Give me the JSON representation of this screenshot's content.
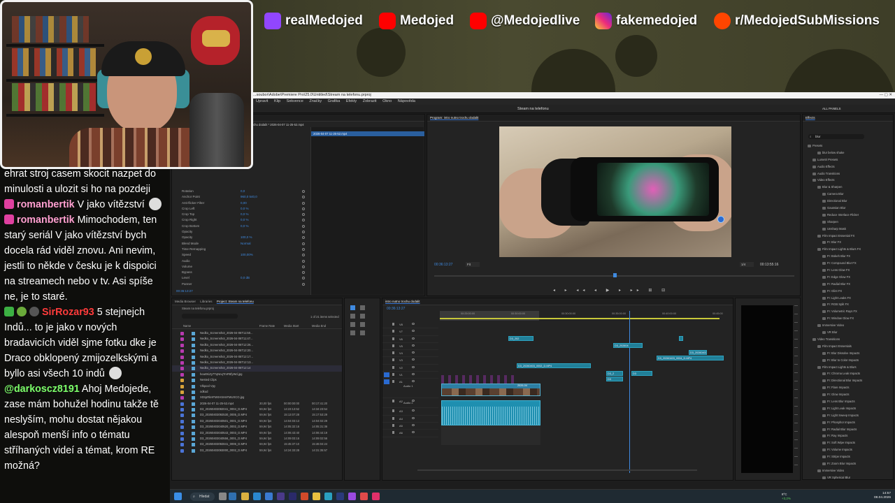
{
  "banner": {
    "socials": [
      {
        "platform": "twitch-icon",
        "handle": "realMedojed",
        "color": "#9146ff"
      },
      {
        "platform": "youtube-icon",
        "handle": "Medojed",
        "color": "#ff0000"
      },
      {
        "platform": "youtube-icon",
        "handle": "@Medojedlive",
        "color": "#ff0000"
      },
      {
        "platform": "instagram-icon",
        "handle": "fakemedojed",
        "color": "#d62976"
      },
      {
        "platform": "reddit-icon",
        "handle": "r/MedojedSubMissions",
        "color": "#ff4500"
      }
    ]
  },
  "chat": {
    "messages": [
      {
        "user": "",
        "text": "ehrat stroj casem skocit nazpet do minulosti a ulozit si ho na pozdeji",
        "user_color": "#ffffff"
      },
      {
        "user": "romanbertik",
        "text": "V jako vítězství",
        "user_color": "#ff9fd0",
        "emote_after": "ghost-emote"
      },
      {
        "user": "romanbertik",
        "text": "Mimochodem, ten starý seriál V jako vítězství bych docela rád viděl znovu. Ani nevim, jestli to někde v česku je k dispoici na streamech nebo v tv. Asi spíše ne, je to staré.",
        "user_color": "#ff9fd0"
      },
      {
        "user": "SirRozar93",
        "text": "5 stejnejch Indů... to je jako v nových bradavicích viděl sjme fotku dke je Draco obklopený zmijozelkskými a byllo asi všech 10 indů",
        "user_color": "#ff3b3b"
      },
      {
        "user": "@darkoscz8191",
        "text": "Ahoj Medojede, zase mám bohužel hodinu takže tě neslyším, mohu dostat nějakou alespoň menší info o tématu stříhaných videí a témat, krom RE možná?",
        "user_color": "#7cff6a"
      }
    ]
  },
  "premiere": {
    "titlebar": "...soubor\\Adobe\\Premiere Pro\\25.0\\Untitled\\Stream na telefonu.prproj",
    "menu": [
      "Upravit",
      "Klip",
      "Sekvence",
      "Značky",
      "Grafika",
      "Efekty",
      "Zobrazit",
      "Okno",
      "Nápověda"
    ],
    "workspace_title": "Steam na telefonu",
    "all_panels": "ALL PANELS",
    "effect_controls": {
      "tabs": [
        "Effect Controls",
        "Essential Graphics",
        "Source: (no clips)"
      ],
      "source_label": "Intro nutno trochu dodalit * 2026-04-07 11-25-52.mp4",
      "clip_label": "2026-04-07 11-25-52.mp4",
      "properties": [
        {
          "name": "Rotation",
          "value": "0,0"
        },
        {
          "name": "Anchor Point",
          "value": "960,0   540,0"
        },
        {
          "name": "Anti-flicker Filter",
          "value": "0,00"
        },
        {
          "name": "Crop Left",
          "value": "0,0 %"
        },
        {
          "name": "Crop Top",
          "value": "0,0 %"
        },
        {
          "name": "Crop Right",
          "value": "0,0 %"
        },
        {
          "name": "Crop Bottom",
          "value": "0,0 %"
        },
        {
          "name": "Opacity",
          "value": ""
        },
        {
          "name": "Opacity",
          "value": "100,0 %"
        },
        {
          "name": "Blend Mode",
          "value": "Normal"
        },
        {
          "name": "Time Remapping",
          "value": ""
        },
        {
          "name": "Speed",
          "value": "100,00%"
        },
        {
          "name": "Audio",
          "value": ""
        },
        {
          "name": "Volume",
          "value": ""
        },
        {
          "name": "Bypass",
          "value": ""
        },
        {
          "name": "Level",
          "value": "0,0 dB"
        },
        {
          "name": "Panner",
          "value": ""
        }
      ],
      "timecode": "00:36:13:27"
    },
    "program": {
      "tab": "Program: intro nutno trochu dodalit",
      "timecode_left": "00:36:13:27",
      "fit": "Fit",
      "zoom": "1/4",
      "timecode_right": "00:13:55:16"
    },
    "project": {
      "tabs": [
        "Media Browser",
        "Libraries",
        "Project: Steam na telefonu"
      ],
      "path": "Steam na telefonu.prproj",
      "items_selected": "1 of 21 items selected",
      "columns": [
        "Name",
        "Frame Rate",
        "Media Start",
        "Media End"
      ],
      "rows": [
        {
          "name": "Nedko_Screenshot_2026-04-06T11:50...",
          "fr": "",
          "ms": "",
          "me": "",
          "color": "#b83ab0"
        },
        {
          "name": "Nedko_Screenshot_2026-04-06T11:47...",
          "fr": "",
          "ms": "",
          "me": "",
          "color": "#b83ab0"
        },
        {
          "name": "Nedko_Screenshot_2026-04-06T12:26...",
          "fr": "",
          "ms": "",
          "me": "",
          "color": "#b83ab0"
        },
        {
          "name": "Nedko_Screenshot_2026-04-06T12:20...",
          "fr": "",
          "ms": "",
          "me": "",
          "color": "#b83ab0"
        },
        {
          "name": "Nedko_Screenshot_2026-04-06T12:17...",
          "fr": "",
          "ms": "",
          "me": "",
          "color": "#b83ab0"
        },
        {
          "name": "Nedko_Screenshot_2026-04-06T12:13...",
          "fr": "",
          "ms": "",
          "me": "",
          "color": "#b83ab0"
        },
        {
          "name": "Nedko_Screenshot_2026-04-06T12:14",
          "fr": "",
          "ms": "",
          "me": "",
          "color": "#b83ab0"
        },
        {
          "name": "heartKiZy7TqNnqTmFBfyWd.jpg",
          "fr": "",
          "ms": "",
          "me": "",
          "color": "#b83ab0"
        },
        {
          "name": "Nested Clips",
          "fr": "",
          "ms": "",
          "me": "",
          "color": "#d8a33a"
        },
        {
          "name": "Vlkpool Vpy",
          "fr": "",
          "ms": "",
          "me": "",
          "color": "#d8a33a"
        },
        {
          "name": "odkud",
          "fr": "",
          "ms": "",
          "me": "",
          "color": "#d8a33a"
        },
        {
          "name": "X0SpRkHFMXHSHnFMUXCO.jpg",
          "fr": "",
          "ms": "",
          "me": "",
          "color": "#b83ab0"
        },
        {
          "name": "2026-04-07 11-25-52.mp4",
          "fr": "30,00 fps",
          "ms": "00:00:00:00",
          "me": "00:17:41:20",
          "color": "#4a74d8"
        },
        {
          "name": "D3_20260403082041_0004_D.MP4",
          "fr": "59,94 fps",
          "ms": "14:23:13:52",
          "me": "14:34:23:54",
          "color": "#4a74d8"
        },
        {
          "name": "D3_20260403092530_0005_D.MP4",
          "fr": "59,94 fps",
          "ms": "15:13:07:28",
          "me": "15:17:53:29",
          "color": "#4a74d8"
        },
        {
          "name": "D3_20260403040501_0001_D.MP4",
          "fr": "59,94 fps",
          "ms": "14:04:03:13",
          "me": "14:04:02:29",
          "color": "#4a74d8"
        },
        {
          "name": "D3_20260403040520_0002_D.MP4",
          "fr": "59,94 fps",
          "ms": "14:05:32:16",
          "me": "14:05:31:36",
          "color": "#4a74d8"
        },
        {
          "name": "D3_20260403040543_0003_D.MP4",
          "fr": "59,94 fps",
          "ms": "14:06:43:40",
          "me": "14:06:44:19",
          "color": "#4a74d8"
        },
        {
          "name": "D3_20260403040556_0001_D.MP4",
          "fr": "59,94 fps",
          "ms": "14:09:03:16",
          "me": "14:09:02:56",
          "color": "#4a74d8"
        },
        {
          "name": "D3_20260403092841_0006_D.MP4",
          "fr": "59,94 fps",
          "ms": "15:45:37:10",
          "me": "15:46:04:24",
          "color": "#4a74d8"
        },
        {
          "name": "D3_20260403083000_0002_D.MP4",
          "fr": "59,94 fps",
          "ms": "14:24:33:28",
          "me": "14:31:35:57",
          "color": "#4a74d8"
        }
      ]
    },
    "timeline": {
      "tab": "intro nutno trochu dodalit",
      "timecode": "00:36:13:27",
      "ruler": [
        "00:25:00:00",
        "00:30:00:00",
        "00:35:00:00",
        "00:40:00:00",
        "00:45:00"
      ],
      "video_tracks": [
        "V8",
        "V7",
        "V6",
        "V5",
        "V4",
        "V3",
        "V2",
        "V1"
      ],
      "audio_tracks": [
        "A1",
        "A2",
        "A3",
        "A4",
        "A5",
        "A6"
      ],
      "audio_labels": [
        "Audio 1",
        "Audio 2"
      ],
      "clips": [
        "D3_202",
        "D3_202604",
        "D3_20260403",
        "D3_20260403_0002_D.MP4",
        "D3_20260403_0004_D.MP4",
        "D3_2",
        "D3",
        "2026-04"
      ]
    },
    "effects": {
      "tab": "Effects",
      "search": "blur",
      "items": [
        {
          "label": "Presets",
          "indent": 0
        },
        {
          "label": "blur below shake",
          "indent": 2
        },
        {
          "label": "Lumetri Presets",
          "indent": 1
        },
        {
          "label": "Audio Effects",
          "indent": 1
        },
        {
          "label": "Audio Transitions",
          "indent": 1
        },
        {
          "label": "Video Effects",
          "indent": 1
        },
        {
          "label": "Blur & Sharpen",
          "indent": 2
        },
        {
          "label": "Camera Blur",
          "indent": 3
        },
        {
          "label": "Directional Blur",
          "indent": 3
        },
        {
          "label": "Gaussian Blur",
          "indent": 3
        },
        {
          "label": "Reduce Interlace Flicker",
          "indent": 3
        },
        {
          "label": "Sharpen",
          "indent": 3
        },
        {
          "label": "Unsharp Mask",
          "indent": 3
        },
        {
          "label": "Film Impact Essential FX",
          "indent": 2
        },
        {
          "label": "FI: Blur FX",
          "indent": 3
        },
        {
          "label": "Film Impact Lights & Blurs FX",
          "indent": 2
        },
        {
          "label": "FI: Bokeh Blur FX",
          "indent": 3
        },
        {
          "label": "FI: Compound Blur FX",
          "indent": 3
        },
        {
          "label": "FI: Lens Glow FX",
          "indent": 3
        },
        {
          "label": "FI: Edge Glow FX",
          "indent": 3
        },
        {
          "label": "FI: Radial Blur FX",
          "indent": 3
        },
        {
          "label": "FI: Glint FX",
          "indent": 3
        },
        {
          "label": "FI: Light Leaks FX",
          "indent": 3
        },
        {
          "label": "FI: RGB Split FX",
          "indent": 3
        },
        {
          "label": "FI: Volumetric Rays FX",
          "indent": 3
        },
        {
          "label": "FI: Window Glow FX",
          "indent": 3
        },
        {
          "label": "Immersive Video",
          "indent": 2
        },
        {
          "label": "VR Blur",
          "indent": 3
        },
        {
          "label": "Video Transitions",
          "indent": 1
        },
        {
          "label": "Film Impact Essentials",
          "indent": 2
        },
        {
          "label": "FI: Blur Dissolve Impacts",
          "indent": 3
        },
        {
          "label": "FI: Blur to Color Impacts",
          "indent": 3
        },
        {
          "label": "Film Impact Lights & Blurs",
          "indent": 2
        },
        {
          "label": "FI: Chroma Leak Impacts",
          "indent": 3
        },
        {
          "label": "FI: Directional Blur Impacts",
          "indent": 3
        },
        {
          "label": "FI: Flare Impacts",
          "indent": 3
        },
        {
          "label": "FI: Glow Impacts",
          "indent": 3
        },
        {
          "label": "FI: Lens Blur Impacts",
          "indent": 3
        },
        {
          "label": "FI: Light Leak Impacts",
          "indent": 3
        },
        {
          "label": "FI: Light Sweep Impacts",
          "indent": 3
        },
        {
          "label": "FI: Phosphor Impacts",
          "indent": 3
        },
        {
          "label": "FI: Radial Blur Impacts",
          "indent": 3
        },
        {
          "label": "FI: Ray Impacts",
          "indent": 3
        },
        {
          "label": "FI: Soft Wipe Impacts",
          "indent": 3
        },
        {
          "label": "FI: Volume Impacts",
          "indent": 3
        },
        {
          "label": "FI: Stripe Impacts",
          "indent": 3
        },
        {
          "label": "FI: Zoom Blur Impacts",
          "indent": 3
        },
        {
          "label": "Immersive Video",
          "indent": 2
        },
        {
          "label": "VR Spherical Blur",
          "indent": 3
        }
      ]
    }
  },
  "taskbar": {
    "search": "Hledat",
    "weather_temp": "8°C",
    "weather_delta": "+3,2%",
    "time": "14:57",
    "date": "08.04.2026"
  }
}
